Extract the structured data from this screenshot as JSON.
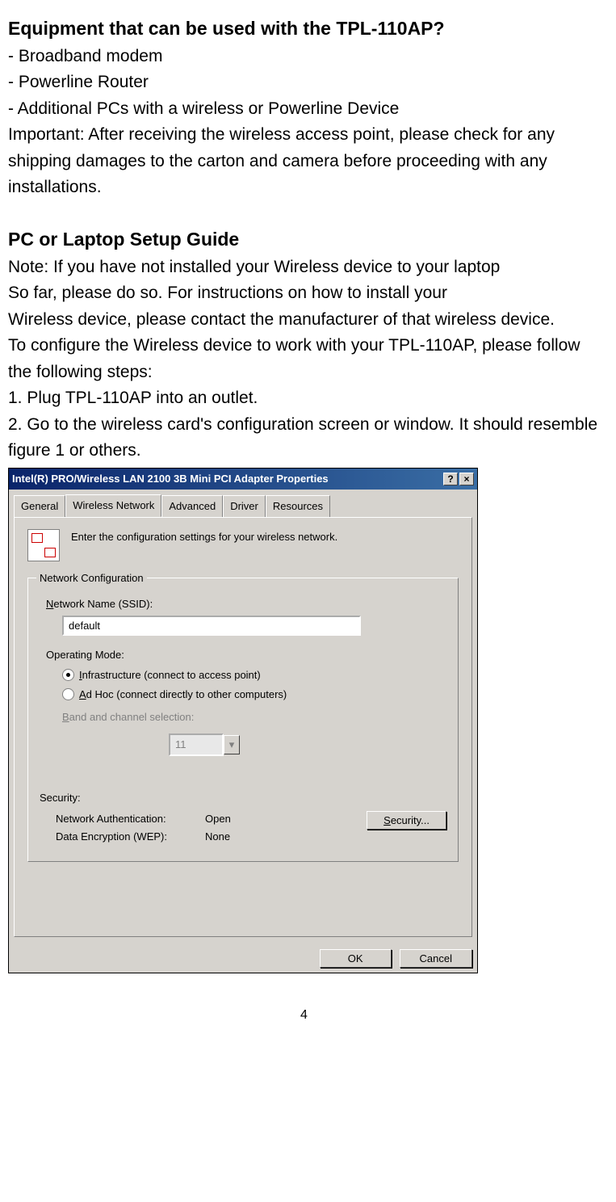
{
  "doc": {
    "heading1": "Equipment that can be used with the TPL-110AP?",
    "bullets": [
      "- Broadband modem",
      "- Powerline Router",
      "- Additional PCs with a wireless or Powerline Device"
    ],
    "important": "Important: After receiving the wireless access point, please check for any shipping damages to the carton and camera before proceeding with any installations.",
    "heading2": "PC or Laptop Setup Guide",
    "note1": "Note: If you have not installed your Wireless device to your laptop",
    "note2": "So far, please do so. For instructions on how to install your",
    "note3": "Wireless device, please contact the manufacturer of that wireless device.",
    "config1": "To configure the Wireless device to work with your TPL-110AP, please follow the following steps:",
    "step1": "1. Plug TPL-110AP into an outlet.",
    "step2": "2. Go to the wireless card's configuration screen or window. It should resemble figure 1 or others.",
    "page_number": "4"
  },
  "dialog": {
    "title": "Intel(R) PRO/Wireless LAN 2100 3B Mini PCI Adapter Properties",
    "help_btn": "?",
    "close_btn": "×",
    "tabs": {
      "general": "General",
      "wireless": "Wireless Network",
      "advanced": "Advanced",
      "driver": "Driver",
      "resources": "Resources"
    },
    "intro": "Enter the configuration settings for your wireless network.",
    "fieldset_legend": "Network Configuration",
    "ssid_label": "Network Name (SSID):",
    "ssid_value": "default",
    "opmode_label": "Operating Mode:",
    "radio_infra": "Infrastructure (connect to access point)",
    "radio_adhoc": "Ad Hoc (connect directly to other computers)",
    "band_label": "Band and channel selection:",
    "channel_value": "11",
    "security_heading": "Security:",
    "auth_label": "Network Authentication:",
    "auth_value": "Open",
    "wep_label": "Data Encryption (WEP):",
    "wep_value": "None",
    "security_btn": "Security...",
    "ok_btn": "OK",
    "cancel_btn": "Cancel"
  }
}
